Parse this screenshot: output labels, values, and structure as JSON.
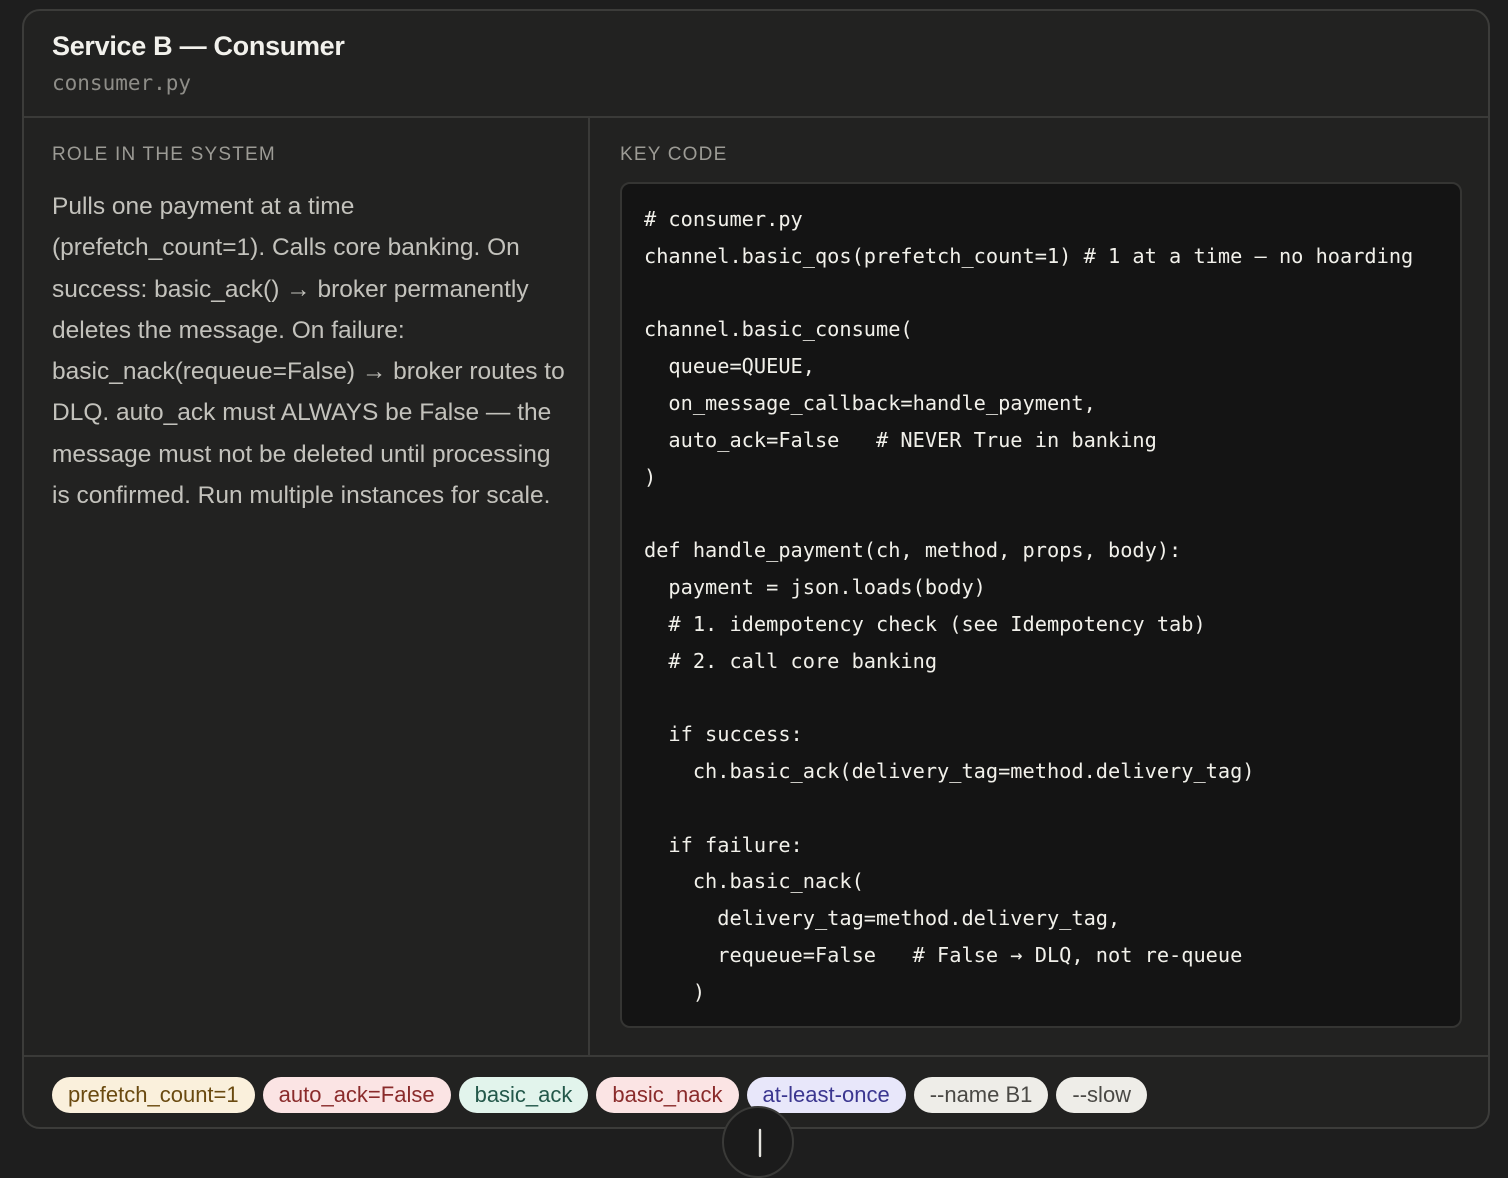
{
  "header": {
    "title": "Service B — Consumer",
    "filename": "consumer.py"
  },
  "role": {
    "label": "ROLE IN THE SYSTEM",
    "text": "Pulls one payment at a time (prefetch_count=1). Calls core banking. On success: basic_ack() → broker permanently deletes the message. On failure: basic_nack(requeue=False) → broker routes to DLQ. auto_ack must ALWAYS be False — the message must not be deleted until processing is confirmed. Run multiple instances for scale."
  },
  "code": {
    "label": "KEY CODE",
    "source": "# consumer.py\nchannel.basic_qos(prefetch_count=1) # 1 at a time — no hoarding\n\nchannel.basic_consume(\n  queue=QUEUE,\n  on_message_callback=handle_payment,\n  auto_ack=False   # NEVER True in banking\n)\n\ndef handle_payment(ch, method, props, body):\n  payment = json.loads(body)\n  # 1. idempotency check (see Idempotency tab)\n  # 2. call core banking\n\n  if success:\n    ch.basic_ack(delivery_tag=method.delivery_tag)\n\n  if failure:\n    ch.basic_nack(\n      delivery_tag=method.delivery_tag,\n      requeue=False   # False → DLQ, not re-queue\n    )"
  },
  "tags": [
    {
      "label": "prefetch_count=1",
      "bg": "#faf0dc",
      "fg": "#6a4a10"
    },
    {
      "label": "auto_ack=False",
      "bg": "#fbe4e4",
      "fg": "#8a2b2b"
    },
    {
      "label": "basic_ack",
      "bg": "#e2f4ec",
      "fg": "#23584a"
    },
    {
      "label": "basic_nack",
      "bg": "#fbe4e4",
      "fg": "#8a2b2b"
    },
    {
      "label": "at-least-once",
      "bg": "#e8e7fa",
      "fg": "#3b3690"
    },
    {
      "label": "--name B1",
      "bg": "#eeede8",
      "fg": "#4a4945"
    },
    {
      "label": "--slow",
      "bg": "#eeede8",
      "fg": "#4a4945"
    }
  ],
  "scroll_button": {
    "icon": "arrow-down-icon"
  }
}
